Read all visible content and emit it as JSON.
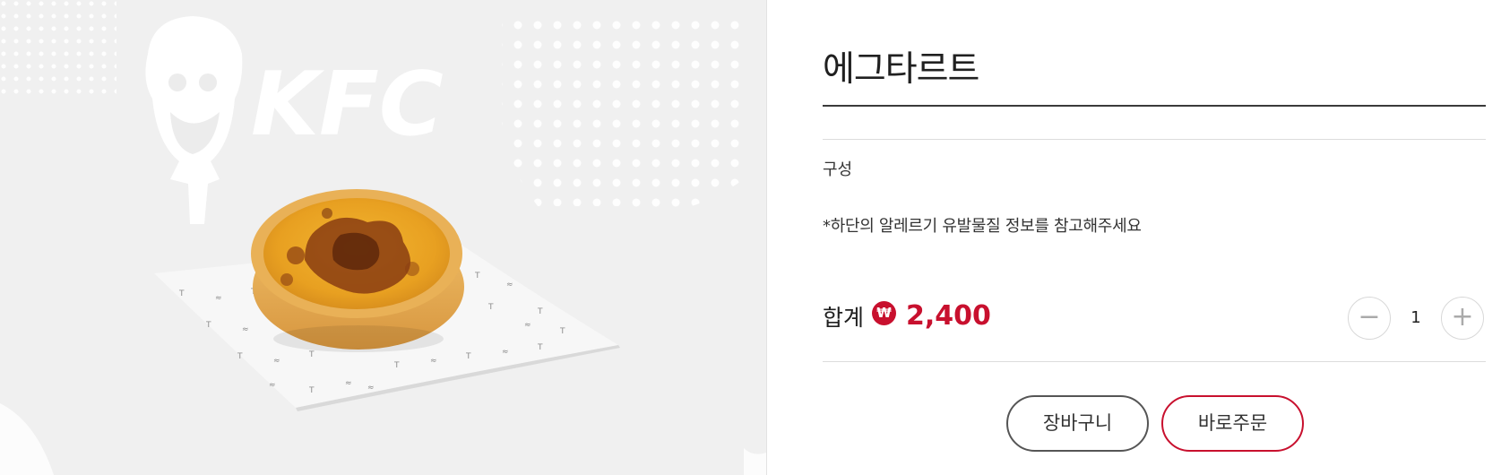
{
  "product": {
    "name": "에그타르트",
    "image_alt": "에그타르트",
    "brand_logo_text": "KFC"
  },
  "details": {
    "composition_label": "구성",
    "allergy_note": "*하단의 알레르기 유발물질 정보를 참고해주세요"
  },
  "total": {
    "label": "합계",
    "currency_symbol": "₩",
    "price": "2,400"
  },
  "quantity": {
    "value": "1",
    "minus_icon": "minus-icon",
    "plus_icon": "plus-icon"
  },
  "actions": {
    "cart_label": "장바구니",
    "order_label": "바로주문"
  },
  "colors": {
    "accent": "#c8102e",
    "background_left": "#f0f0f0"
  }
}
